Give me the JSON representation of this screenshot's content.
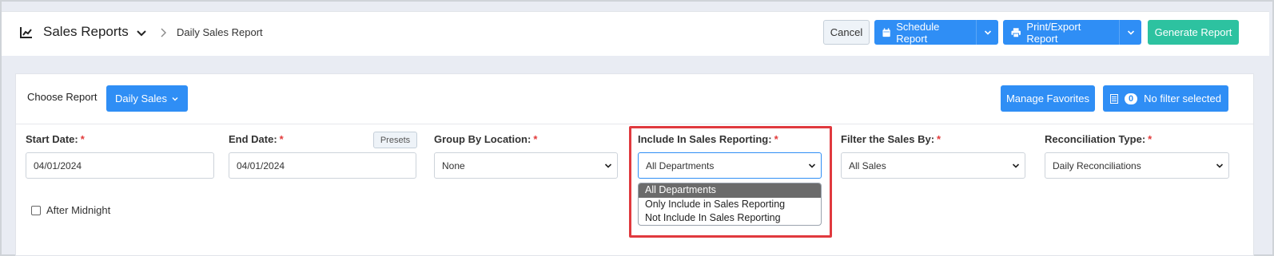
{
  "header": {
    "title": "Sales Reports",
    "breadcrumb_current": "Daily Sales Report",
    "buttons": {
      "cancel": "Cancel",
      "schedule": "Schedule Report",
      "print": "Print/Export Report",
      "generate": "Generate Report"
    },
    "icons": {
      "title": "line-chart-icon",
      "title_toggle": "chevron-down-icon",
      "breadcrumb_separator": "chevron-right-icon",
      "schedule": "calendar-icon",
      "print": "printer-icon"
    }
  },
  "report_bar": {
    "choose_label": "Choose Report",
    "selected_report": "Daily Sales",
    "manage_favorites": "Manage Favorites",
    "filter_count": "0",
    "filter_text": "No filter selected",
    "icons": {
      "filter": "list-icon"
    }
  },
  "filters": {
    "start_date": {
      "label": "Start Date:",
      "required": "*",
      "value": "04/01/2024"
    },
    "end_date": {
      "label": "End Date:",
      "required": "*",
      "value": "04/01/2024",
      "presets_label": "Presets"
    },
    "group_by_location": {
      "label": "Group By Location:",
      "required": "*",
      "value": "None"
    },
    "include_in_sales_reporting": {
      "label": "Include In Sales Reporting:",
      "required": "*",
      "value": "All Departments",
      "options": [
        "All Departments",
        "Only Include in Sales Reporting",
        "Not Include In Sales Reporting"
      ],
      "selected_index": 0
    },
    "filter_sales_by": {
      "label": "Filter the Sales By:",
      "required": "*",
      "value": "All Sales"
    },
    "reconciliation_type": {
      "label": "Reconciliation Type:",
      "required": "*",
      "value": "Daily Reconciliations"
    },
    "after_midnight": {
      "label": "After Midnight",
      "checked": false
    }
  },
  "colors": {
    "primary": "#2f8ef5",
    "success": "#2dc2a0",
    "required": "#e23b3b",
    "highlight": "#e0393e"
  }
}
